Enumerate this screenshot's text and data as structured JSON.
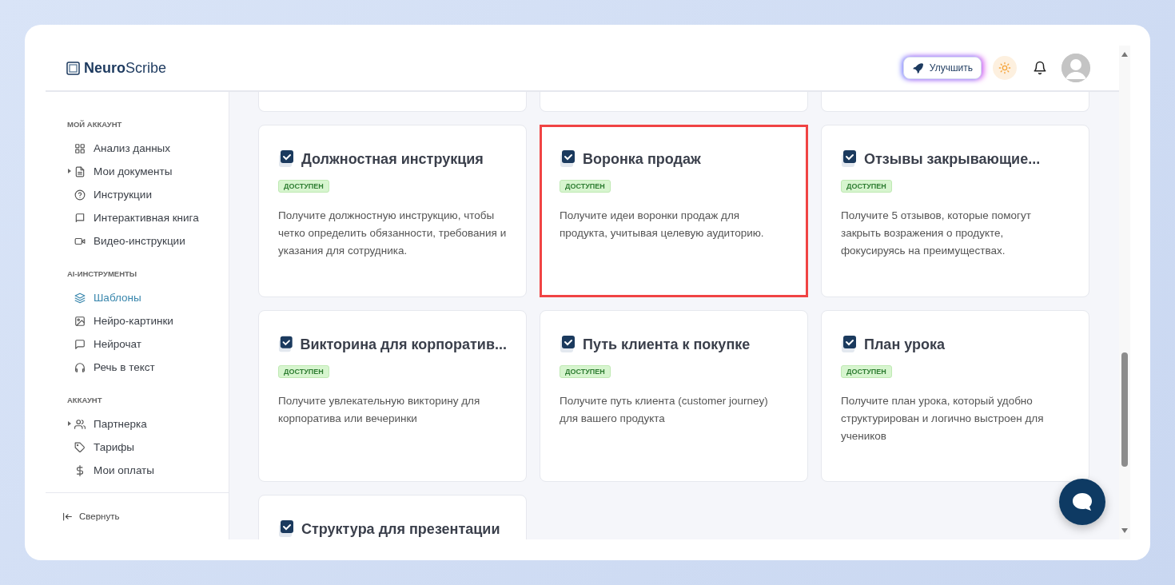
{
  "logo": {
    "text": "**Neuro**Scribe"
  },
  "header": {
    "upgrade_button": "Улучшить"
  },
  "sidebar": {
    "sections": [
      {
        "title": "МОЙ АККАУНТ",
        "items": [
          {
            "label": "Анализ данных",
            "selected": false
          },
          {
            "label": "Мои документы",
            "selected": false,
            "expanded": false
          },
          {
            "label": "Инструкции",
            "selected": false
          },
          {
            "label": "Интерактивная книга",
            "selected": false
          },
          {
            "label": "Видео-инструкции",
            "selected": false
          }
        ]
      },
      {
        "title": "AI-ИНСТРУМЕНТЫ",
        "items": [
          {
            "label": "Шаблоны",
            "selected": true
          },
          {
            "label": "Нейро-картинки",
            "selected": false
          },
          {
            "label": "Нейрочат",
            "selected": false
          },
          {
            "label": "Речь в текст",
            "selected": false
          }
        ]
      },
      {
        "title": "АККАУНТ",
        "items": [
          {
            "label": "Партнерка",
            "selected": false,
            "expanded": false
          },
          {
            "label": "Тарифы",
            "selected": false
          },
          {
            "label": "Мои оплаты",
            "selected": false
          }
        ]
      }
    ],
    "collapse_button": "Свернуть"
  },
  "cards": [
    {
      "title": "Должностная инструкция",
      "badge": "ДОСТУПЕН",
      "description": "Получите должностную инструкцию, чтобы четко определить обязанности, требования и указания для сотрудника.",
      "selected": false
    },
    {
      "title": "Воронка продаж",
      "badge": "ДОСТУПЕН",
      "description": "Получите идеи воронки продаж для продукта, учитывая целевую аудиторию.",
      "selected": true
    },
    {
      "title": "Отзывы закрывающие...",
      "badge": "ДОСТУПЕН",
      "description": "Получите 5 отзывов, которые помогут закрыть возражения о продукте, фокусируясь на преимуществах.",
      "selected": false
    },
    {
      "title": "Викторина для корпоратив...",
      "badge": "ДОСТУПЕН",
      "description": "Получите увлекательную викторину для корпоратива или вечеринки",
      "selected": false
    },
    {
      "title": "Путь клиента к покупке",
      "badge": "ДОСТУПЕН",
      "description": "Получите путь клиента (customer journey) для вашего продукта",
      "selected": false
    },
    {
      "title": "План урока",
      "badge": "ДОСТУПЕН",
      "description": "Получите план урока, который удобно структурирован и логично выстроен для учеников",
      "selected": false
    },
    {
      "title": "Структура для презентации",
      "selected": false
    }
  ]
}
